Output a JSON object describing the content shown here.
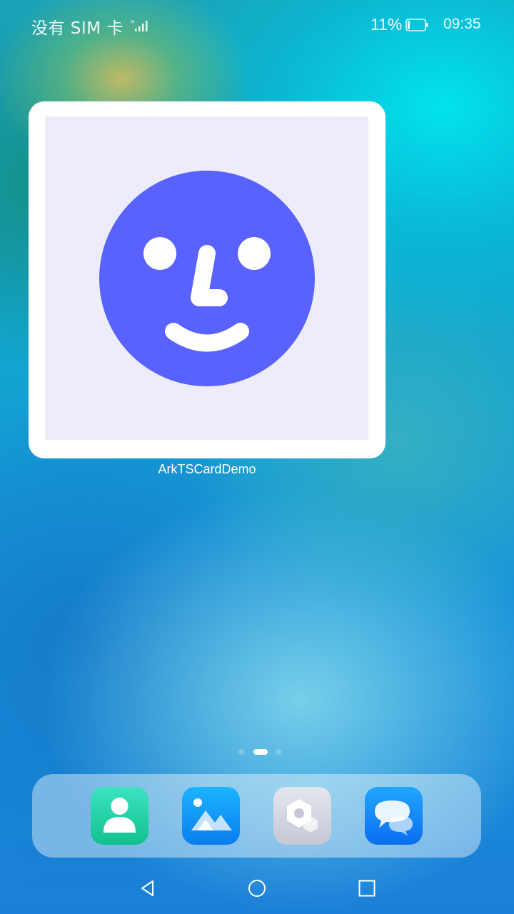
{
  "status_bar": {
    "carrier": "没有 SIM 卡",
    "battery_percent": "11%",
    "time": "09:35",
    "battery_level": 0.11
  },
  "widget": {
    "label": "ArkTSCardDemo",
    "face_color": "#5961ff",
    "card_background": "#ededf9"
  },
  "page_indicator": {
    "pages": 3,
    "active_index": 1
  },
  "dock": {
    "apps": [
      {
        "icon": "contacts-icon"
      },
      {
        "icon": "gallery-icon"
      },
      {
        "icon": "settings-icon"
      },
      {
        "icon": "messages-icon"
      }
    ]
  },
  "nav_bar": {
    "buttons": [
      "back-icon",
      "home-icon",
      "recents-icon"
    ]
  }
}
